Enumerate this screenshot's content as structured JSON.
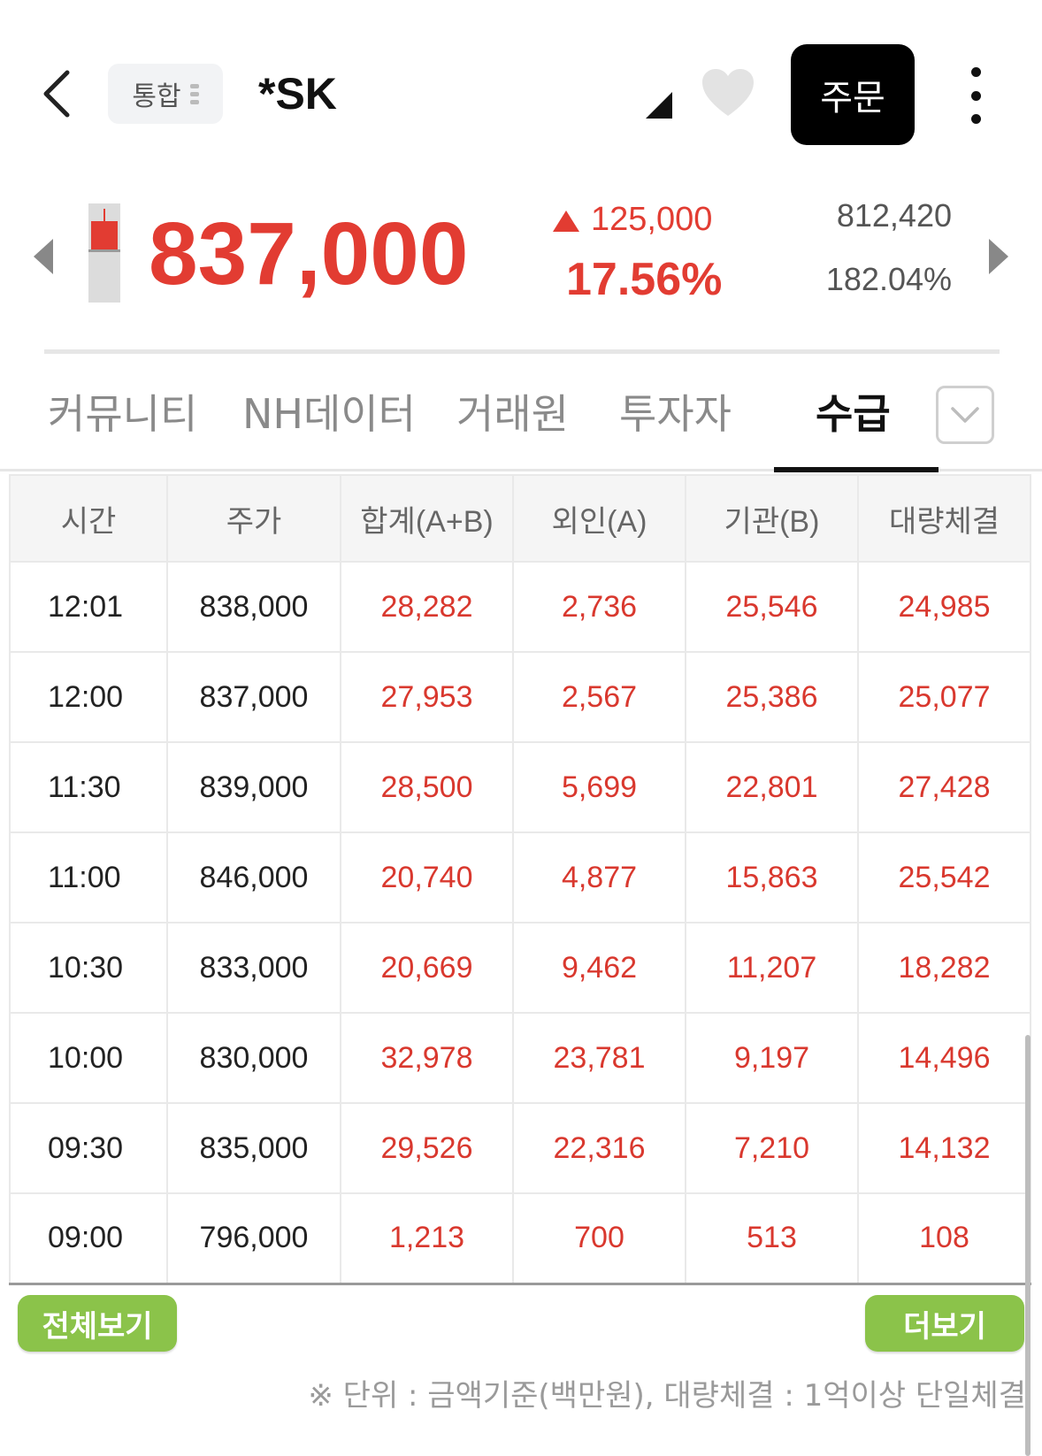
{
  "header": {
    "market_label": "통합",
    "stock_name": "*SK",
    "order_label": "주문"
  },
  "price": {
    "current": "837,000",
    "change_amount": "125,000",
    "change_rate": "17.56%",
    "volume": "812,420",
    "volume_rate": "182.04%",
    "up_color": "#e23c32"
  },
  "tabs": [
    {
      "label": "커뮤니티",
      "active": false
    },
    {
      "label": "NH데이터",
      "active": false
    },
    {
      "label": "거래원",
      "active": false
    },
    {
      "label": "투자자",
      "active": false
    },
    {
      "label": "수급",
      "active": true
    }
  ],
  "table": {
    "headers": [
      "시간",
      "주가",
      "합계(A+B)",
      "외인(A)",
      "기관(B)",
      "대량체결"
    ],
    "rows": [
      [
        "12:01",
        "838,000",
        "28,282",
        "2,736",
        "25,546",
        "24,985"
      ],
      [
        "12:00",
        "837,000",
        "27,953",
        "2,567",
        "25,386",
        "25,077"
      ],
      [
        "11:30",
        "839,000",
        "28,500",
        "5,699",
        "22,801",
        "27,428"
      ],
      [
        "11:00",
        "846,000",
        "20,740",
        "4,877",
        "15,863",
        "25,542"
      ],
      [
        "10:30",
        "833,000",
        "20,669",
        "9,462",
        "11,207",
        "18,282"
      ],
      [
        "10:00",
        "830,000",
        "32,978",
        "23,781",
        "9,197",
        "14,496"
      ],
      [
        "09:30",
        "835,000",
        "29,526",
        "22,316",
        "7,210",
        "14,132"
      ],
      [
        "09:00",
        "796,000",
        "1,213",
        "700",
        "513",
        "108"
      ]
    ]
  },
  "buttons": {
    "view_all": "전체보기",
    "more": "더보기"
  },
  "footnote": "※ 단위 : 금액기준(백만원), 대량체결 : 1억이상 단일체결",
  "icons": {
    "back": "chevron-left-icon",
    "market_switch": "drag-handle-icon",
    "expand": "corner-triangle-icon",
    "favorite": "heart-icon",
    "more": "vertical-dots-icon",
    "prev_stock": "caret-left-icon",
    "next_stock": "caret-right-icon",
    "tab_expand": "chevron-down-icon"
  }
}
